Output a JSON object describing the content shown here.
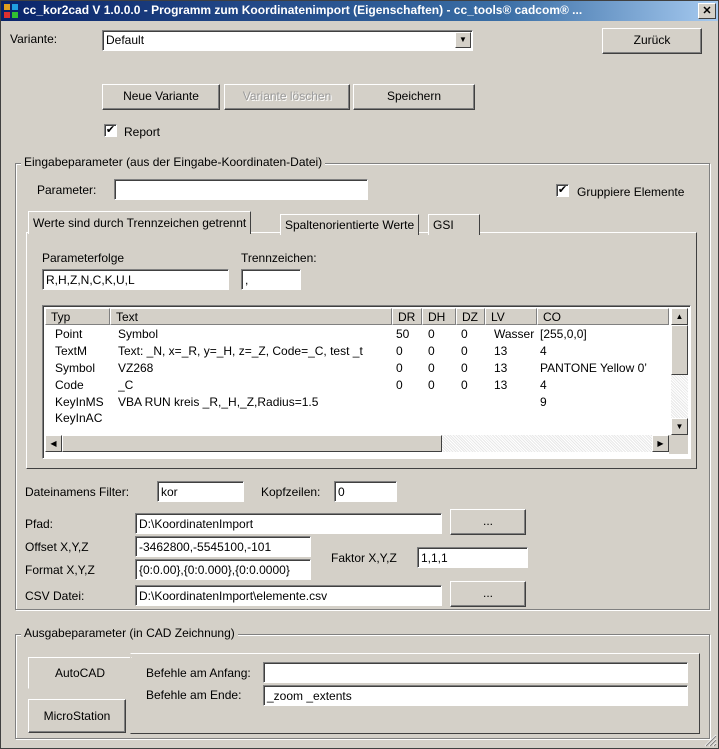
{
  "window": {
    "title": "cc_kor2cad V 1.0.0.0 - Programm zum Koordinatenimport (Eigenschaften) - cc_tools® cadcom® ...",
    "close_glyph": "✕"
  },
  "variant": {
    "label": "Variante:",
    "selected": "Default",
    "back_button": "Zurück",
    "new_button": "Neue Variante",
    "delete_button": "Variante löschen",
    "save_button": "Speichern",
    "report_label": "Report",
    "report_checked": true
  },
  "input_group": {
    "title": "Eingabeparameter (aus der Eingabe-Koordinaten-Datei)",
    "parameter_label": "Parameter:",
    "parameter_value": "",
    "group_elements_label": "Gruppiere Elemente",
    "group_elements_checked": true,
    "tabs": [
      {
        "label": "Werte sind durch Trennzeichen getrennt",
        "active": true
      },
      {
        "label": "Spaltenorientierte Werte",
        "active": false
      },
      {
        "label": "GSI",
        "active": false
      }
    ],
    "param_order_label": "Parameterfolge",
    "param_order_value": "R,H,Z,N,C,K,U,L",
    "separator_label": "Trennzeichen:",
    "separator_value": ",",
    "table": {
      "columns": [
        "Typ",
        "Text",
        "DR",
        "DH",
        "DZ",
        "LV",
        "CO"
      ],
      "rows": [
        [
          "Point",
          "Symbol",
          "50",
          "0",
          "0",
          "Wasser",
          "[255,0,0]"
        ],
        [
          "TextM",
          "Text: _N, x=_R, y=_H, z=_Z, Code=_C, test _t",
          "0",
          "0",
          "0",
          "13",
          "4"
        ],
        [
          "Symbol",
          "VZ268",
          "0",
          "0",
          "0",
          "13",
          "PANTONE Yellow 0’"
        ],
        [
          "Code",
          "_C",
          "0",
          "0",
          "0",
          "13",
          "4"
        ],
        [
          "KeyInMS",
          "VBA RUN kreis _R,_H,_Z,Radius=1.5",
          "",
          "",
          "",
          "",
          "9"
        ],
        [
          "KeyInAC",
          "",
          "",
          "",
          "",
          "",
          ""
        ]
      ]
    },
    "filename_filter_label": "Dateinamens Filter:",
    "filename_filter_value": "kor",
    "header_lines_label": "Kopfzeilen:",
    "header_lines_value": "0",
    "path_label": "Pfad:",
    "path_value": "D:\\KoordinatenImport",
    "browse_label": "...",
    "offset_label": "Offset X,Y,Z",
    "offset_value": "-3462800,-5545100,-101",
    "factor_label": "Faktor X,Y,Z",
    "factor_value": "1,1,1",
    "format_label": "Format X,Y,Z",
    "format_value": "{0:0.00},{0:0.000},{0:0.0000}",
    "csv_label": "CSV Datei:",
    "csv_value": "D:\\KoordinatenImport\\elemente.csv",
    "csv_browse_label": "..."
  },
  "output_group": {
    "title": "Ausgabeparameter (in CAD Zeichnung)",
    "autocad_button": "AutoCAD",
    "microstation_button": "MicroStation",
    "start_commands_label": "Befehle am Anfang:",
    "start_commands_value": "",
    "end_commands_label": "Befehle am Ende:",
    "end_commands_value": "_zoom _extents"
  },
  "icons": {
    "dropdown": "▼",
    "scroll_up": "▲",
    "scroll_down": "▼",
    "scroll_left": "◀",
    "scroll_right": "▶",
    "check": "✔"
  },
  "colors": {
    "titlebar_start": "#0a246a",
    "titlebar_end": "#a6caf0",
    "face": "#d4d0c8"
  }
}
